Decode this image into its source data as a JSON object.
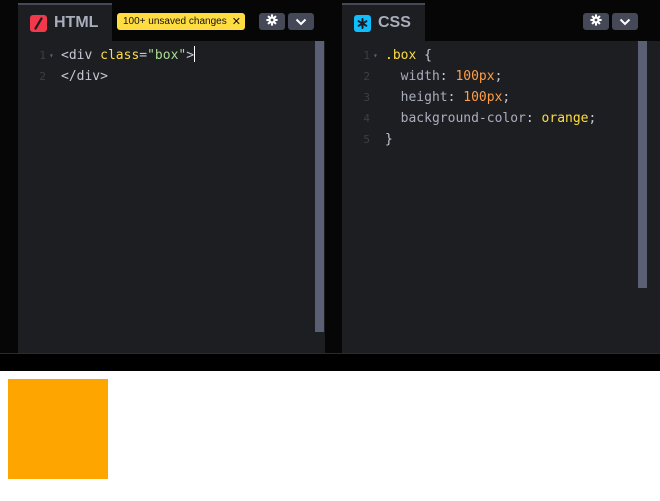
{
  "colors": {
    "editor_bg": "#1d1e22",
    "badge_bg": "#ffdd40",
    "html_icon": "#f2384a",
    "css_icon": "#0ebeff",
    "tag": "#c5c8d4",
    "attr_name": "#ffdd40",
    "attr_value": "#a8dd93",
    "selector": "#ffdd40",
    "property": "#aaaebc",
    "number": "#ff9d47",
    "keyword_value": "#ffdd40",
    "preview_box": "#ffa500"
  },
  "html_panel": {
    "title": "HTML",
    "icon": "slash-icon",
    "badge": "100+ unsaved changes",
    "badge_close_icon": "close-icon",
    "settings_icon": "gear-icon",
    "collapse_icon": "chevron-down-icon",
    "lines": [
      {
        "num": "1",
        "fold": "▾",
        "parts": [
          {
            "t": "<div ",
            "c": "tag"
          },
          {
            "t": "class",
            "c": "attr"
          },
          {
            "t": "=",
            "c": "tag"
          },
          {
            "t": "\"box\"",
            "c": "val"
          },
          {
            "t": ">",
            "c": "tag"
          }
        ]
      },
      {
        "num": "2",
        "fold": "",
        "parts": [
          {
            "t": "</div>",
            "c": "tag"
          }
        ]
      }
    ]
  },
  "css_panel": {
    "title": "CSS",
    "icon": "asterisk-icon",
    "settings_icon": "gear-icon",
    "collapse_icon": "chevron-down-icon",
    "lines": [
      {
        "num": "1",
        "fold": "▾",
        "parts": [
          {
            "t": ".box",
            "c": "sel"
          },
          {
            "t": " {",
            "c": "punct"
          }
        ]
      },
      {
        "num": "2",
        "fold": "",
        "parts": [
          {
            "t": "  width",
            "c": "prop"
          },
          {
            "t": ": ",
            "c": "punct"
          },
          {
            "t": "100px",
            "c": "num"
          },
          {
            "t": ";",
            "c": "punct"
          }
        ]
      },
      {
        "num": "3",
        "fold": "",
        "parts": [
          {
            "t": "  height",
            "c": "prop"
          },
          {
            "t": ": ",
            "c": "punct"
          },
          {
            "t": "100px",
            "c": "num"
          },
          {
            "t": ";",
            "c": "punct"
          }
        ]
      },
      {
        "num": "4",
        "fold": "",
        "parts": [
          {
            "t": "  background-color",
            "c": "prop"
          },
          {
            "t": ": ",
            "c": "punct"
          },
          {
            "t": "orange",
            "c": "kw"
          },
          {
            "t": ";",
            "c": "punct"
          }
        ]
      },
      {
        "num": "5",
        "fold": "",
        "parts": [
          {
            "t": "}",
            "c": "punct"
          }
        ]
      }
    ]
  }
}
